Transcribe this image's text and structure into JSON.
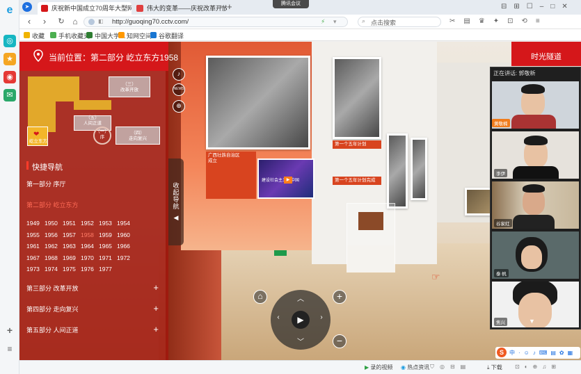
{
  "browser": {
    "tabs": [
      {
        "label": "庆祝新中国成立70周年大型网…",
        "active": true,
        "color": "#d5171a"
      },
      {
        "label": "伟大的变革——庆祝改革开放4…",
        "active": false,
        "color": "#e04040"
      }
    ],
    "new_tab": "+",
    "meeting_pill": "腾讯会议",
    "url": "http://guoqing70.cctv.com/",
    "search_placeholder": "点击搜索",
    "nav": {
      "back": "‹",
      "forward": "›",
      "reload": "↻",
      "home": "⌂"
    },
    "bookmarks": [
      {
        "label": "收藏",
        "color": "#f0b400"
      },
      {
        "label": "手机收藏夹",
        "color": "#4caf50"
      },
      {
        "label": "中国大学…",
        "color": "#2e7d32"
      },
      {
        "label": "知网空间",
        "color": "#ff9800"
      },
      {
        "label": "谷歌翻译",
        "color": "#1976d2"
      }
    ],
    "status_items": [
      "录的视频",
      "热点资讯",
      "下载"
    ]
  },
  "nav_panel": {
    "location_prefix": "当前位置：",
    "location": "第二部分 屹立东方1958",
    "map_labels": {
      "reform": "（三）\n改革开放",
      "people": "（五）\n人间正道",
      "east": "屹立东方",
      "one": "（一）\n序",
      "revival": "（四）\n走向复兴"
    },
    "quick_nav_title": "快捷导航",
    "parts": [
      {
        "label": "第一部分 序厅",
        "active": false,
        "plus": false
      },
      {
        "label": "第二部分 屹立东方",
        "active": true,
        "plus": false
      },
      {
        "label": "第三部分 改革开放",
        "active": false,
        "plus": true
      },
      {
        "label": "第四部分 走向复兴",
        "active": false,
        "plus": true
      },
      {
        "label": "第五部分 人间正道",
        "active": false,
        "plus": true
      }
    ],
    "years": [
      "1949",
      "1950",
      "1951",
      "1952",
      "1953",
      "1954",
      "1955",
      "1956",
      "1957",
      "1958",
      "1959",
      "1960",
      "1961",
      "1962",
      "1963",
      "1964",
      "1965",
      "1966",
      "1967",
      "1968",
      "1969",
      "1970",
      "1971",
      "1972",
      "1973",
      "1974",
      "1975",
      "1976",
      "1977"
    ],
    "highlight_year": "1958",
    "collapse_label": "收\n起\n导\n航",
    "collapse_arrow": "◀"
  },
  "scene": {
    "caption_1": "广西壮族自治区\n成立",
    "caption_2": "第一个五年计划",
    "caption_3": "第一个五年计划完成",
    "video_title": "建设社会主义新中国",
    "side_buttons": {
      "sound": "♪",
      "news": "NEWS",
      "share": "⊕"
    }
  },
  "controls": {
    "home": "⌂",
    "zoom_in": "+",
    "zoom_out": "−",
    "play": "▶",
    "up": "︿",
    "down": "﹀",
    "left": "‹",
    "right": "›",
    "pointer": "☞"
  },
  "right_header": "时光隧道",
  "meeting": {
    "header": "正在讲话: 郭敬新",
    "participants": [
      "黄敬楠",
      "李伊",
      "谷家红",
      "泰  帆",
      "焦兴"
    ],
    "more": "▼"
  }
}
